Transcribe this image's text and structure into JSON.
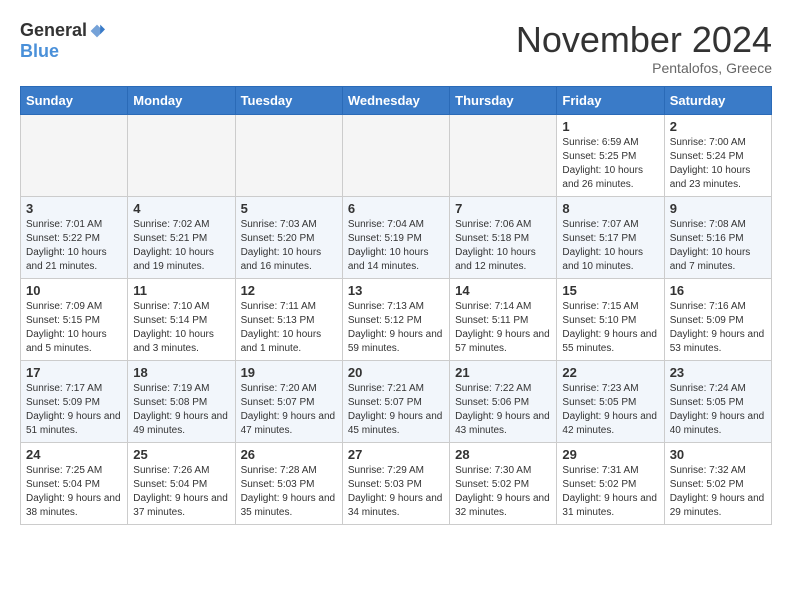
{
  "header": {
    "logo_general": "General",
    "logo_blue": "Blue",
    "title": "November 2024",
    "subtitle": "Pentalofos, Greece"
  },
  "weekdays": [
    "Sunday",
    "Monday",
    "Tuesday",
    "Wednesday",
    "Thursday",
    "Friday",
    "Saturday"
  ],
  "weeks": [
    [
      {
        "day": "",
        "info": ""
      },
      {
        "day": "",
        "info": ""
      },
      {
        "day": "",
        "info": ""
      },
      {
        "day": "",
        "info": ""
      },
      {
        "day": "",
        "info": ""
      },
      {
        "day": "1",
        "info": "Sunrise: 6:59 AM\nSunset: 5:25 PM\nDaylight: 10 hours and 26 minutes."
      },
      {
        "day": "2",
        "info": "Sunrise: 7:00 AM\nSunset: 5:24 PM\nDaylight: 10 hours and 23 minutes."
      }
    ],
    [
      {
        "day": "3",
        "info": "Sunrise: 7:01 AM\nSunset: 5:22 PM\nDaylight: 10 hours and 21 minutes."
      },
      {
        "day": "4",
        "info": "Sunrise: 7:02 AM\nSunset: 5:21 PM\nDaylight: 10 hours and 19 minutes."
      },
      {
        "day": "5",
        "info": "Sunrise: 7:03 AM\nSunset: 5:20 PM\nDaylight: 10 hours and 16 minutes."
      },
      {
        "day": "6",
        "info": "Sunrise: 7:04 AM\nSunset: 5:19 PM\nDaylight: 10 hours and 14 minutes."
      },
      {
        "day": "7",
        "info": "Sunrise: 7:06 AM\nSunset: 5:18 PM\nDaylight: 10 hours and 12 minutes."
      },
      {
        "day": "8",
        "info": "Sunrise: 7:07 AM\nSunset: 5:17 PM\nDaylight: 10 hours and 10 minutes."
      },
      {
        "day": "9",
        "info": "Sunrise: 7:08 AM\nSunset: 5:16 PM\nDaylight: 10 hours and 7 minutes."
      }
    ],
    [
      {
        "day": "10",
        "info": "Sunrise: 7:09 AM\nSunset: 5:15 PM\nDaylight: 10 hours and 5 minutes."
      },
      {
        "day": "11",
        "info": "Sunrise: 7:10 AM\nSunset: 5:14 PM\nDaylight: 10 hours and 3 minutes."
      },
      {
        "day": "12",
        "info": "Sunrise: 7:11 AM\nSunset: 5:13 PM\nDaylight: 10 hours and 1 minute."
      },
      {
        "day": "13",
        "info": "Sunrise: 7:13 AM\nSunset: 5:12 PM\nDaylight: 9 hours and 59 minutes."
      },
      {
        "day": "14",
        "info": "Sunrise: 7:14 AM\nSunset: 5:11 PM\nDaylight: 9 hours and 57 minutes."
      },
      {
        "day": "15",
        "info": "Sunrise: 7:15 AM\nSunset: 5:10 PM\nDaylight: 9 hours and 55 minutes."
      },
      {
        "day": "16",
        "info": "Sunrise: 7:16 AM\nSunset: 5:09 PM\nDaylight: 9 hours and 53 minutes."
      }
    ],
    [
      {
        "day": "17",
        "info": "Sunrise: 7:17 AM\nSunset: 5:09 PM\nDaylight: 9 hours and 51 minutes."
      },
      {
        "day": "18",
        "info": "Sunrise: 7:19 AM\nSunset: 5:08 PM\nDaylight: 9 hours and 49 minutes."
      },
      {
        "day": "19",
        "info": "Sunrise: 7:20 AM\nSunset: 5:07 PM\nDaylight: 9 hours and 47 minutes."
      },
      {
        "day": "20",
        "info": "Sunrise: 7:21 AM\nSunset: 5:07 PM\nDaylight: 9 hours and 45 minutes."
      },
      {
        "day": "21",
        "info": "Sunrise: 7:22 AM\nSunset: 5:06 PM\nDaylight: 9 hours and 43 minutes."
      },
      {
        "day": "22",
        "info": "Sunrise: 7:23 AM\nSunset: 5:05 PM\nDaylight: 9 hours and 42 minutes."
      },
      {
        "day": "23",
        "info": "Sunrise: 7:24 AM\nSunset: 5:05 PM\nDaylight: 9 hours and 40 minutes."
      }
    ],
    [
      {
        "day": "24",
        "info": "Sunrise: 7:25 AM\nSunset: 5:04 PM\nDaylight: 9 hours and 38 minutes."
      },
      {
        "day": "25",
        "info": "Sunrise: 7:26 AM\nSunset: 5:04 PM\nDaylight: 9 hours and 37 minutes."
      },
      {
        "day": "26",
        "info": "Sunrise: 7:28 AM\nSunset: 5:03 PM\nDaylight: 9 hours and 35 minutes."
      },
      {
        "day": "27",
        "info": "Sunrise: 7:29 AM\nSunset: 5:03 PM\nDaylight: 9 hours and 34 minutes."
      },
      {
        "day": "28",
        "info": "Sunrise: 7:30 AM\nSunset: 5:02 PM\nDaylight: 9 hours and 32 minutes."
      },
      {
        "day": "29",
        "info": "Sunrise: 7:31 AM\nSunset: 5:02 PM\nDaylight: 9 hours and 31 minutes."
      },
      {
        "day": "30",
        "info": "Sunrise: 7:32 AM\nSunset: 5:02 PM\nDaylight: 9 hours and 29 minutes."
      }
    ]
  ]
}
